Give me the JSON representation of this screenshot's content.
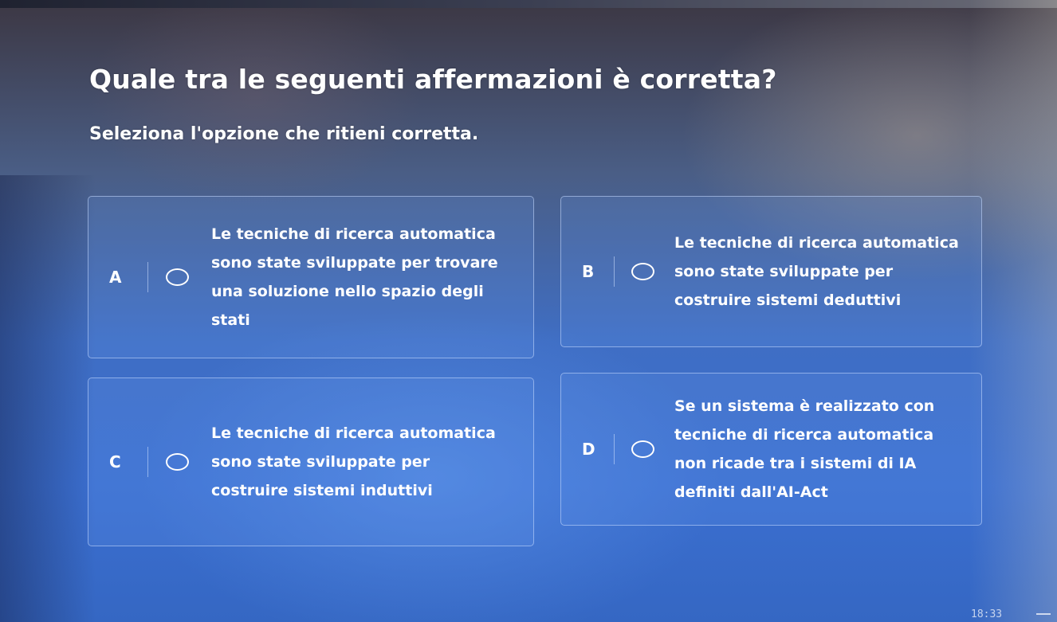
{
  "question": {
    "title": "Quale tra le seguenti affermazioni è corretta?",
    "instruction": "Seleziona l'opzione che ritieni corretta."
  },
  "options": [
    {
      "letter": "A",
      "text": "Le tecniche di ricerca automatica sono state sviluppate per trovare una soluzione nello spazio degli stati",
      "selected": false
    },
    {
      "letter": "B",
      "text": "Le tecniche di ricerca automatica sono state sviluppate per costruire sistemi deduttivi",
      "selected": false
    },
    {
      "letter": "C",
      "text": "Le tecniche di ricerca automatica sono state sviluppate per costruire sistemi induttivi",
      "selected": false
    },
    {
      "letter": "D",
      "text": "Se un sistema è realizzato con tecniche di ricerca automatica non ricade tra i sistemi di IA definiti dall'AI-Act",
      "selected": false
    }
  ],
  "taskbar": {
    "clock": "18:33",
    "tray_icon": "menu-icon"
  },
  "colors": {
    "background_top": "#3c3743",
    "background_bottom": "#3b6fd0",
    "text": "#ffffff",
    "card_border": "#c8dcff"
  }
}
